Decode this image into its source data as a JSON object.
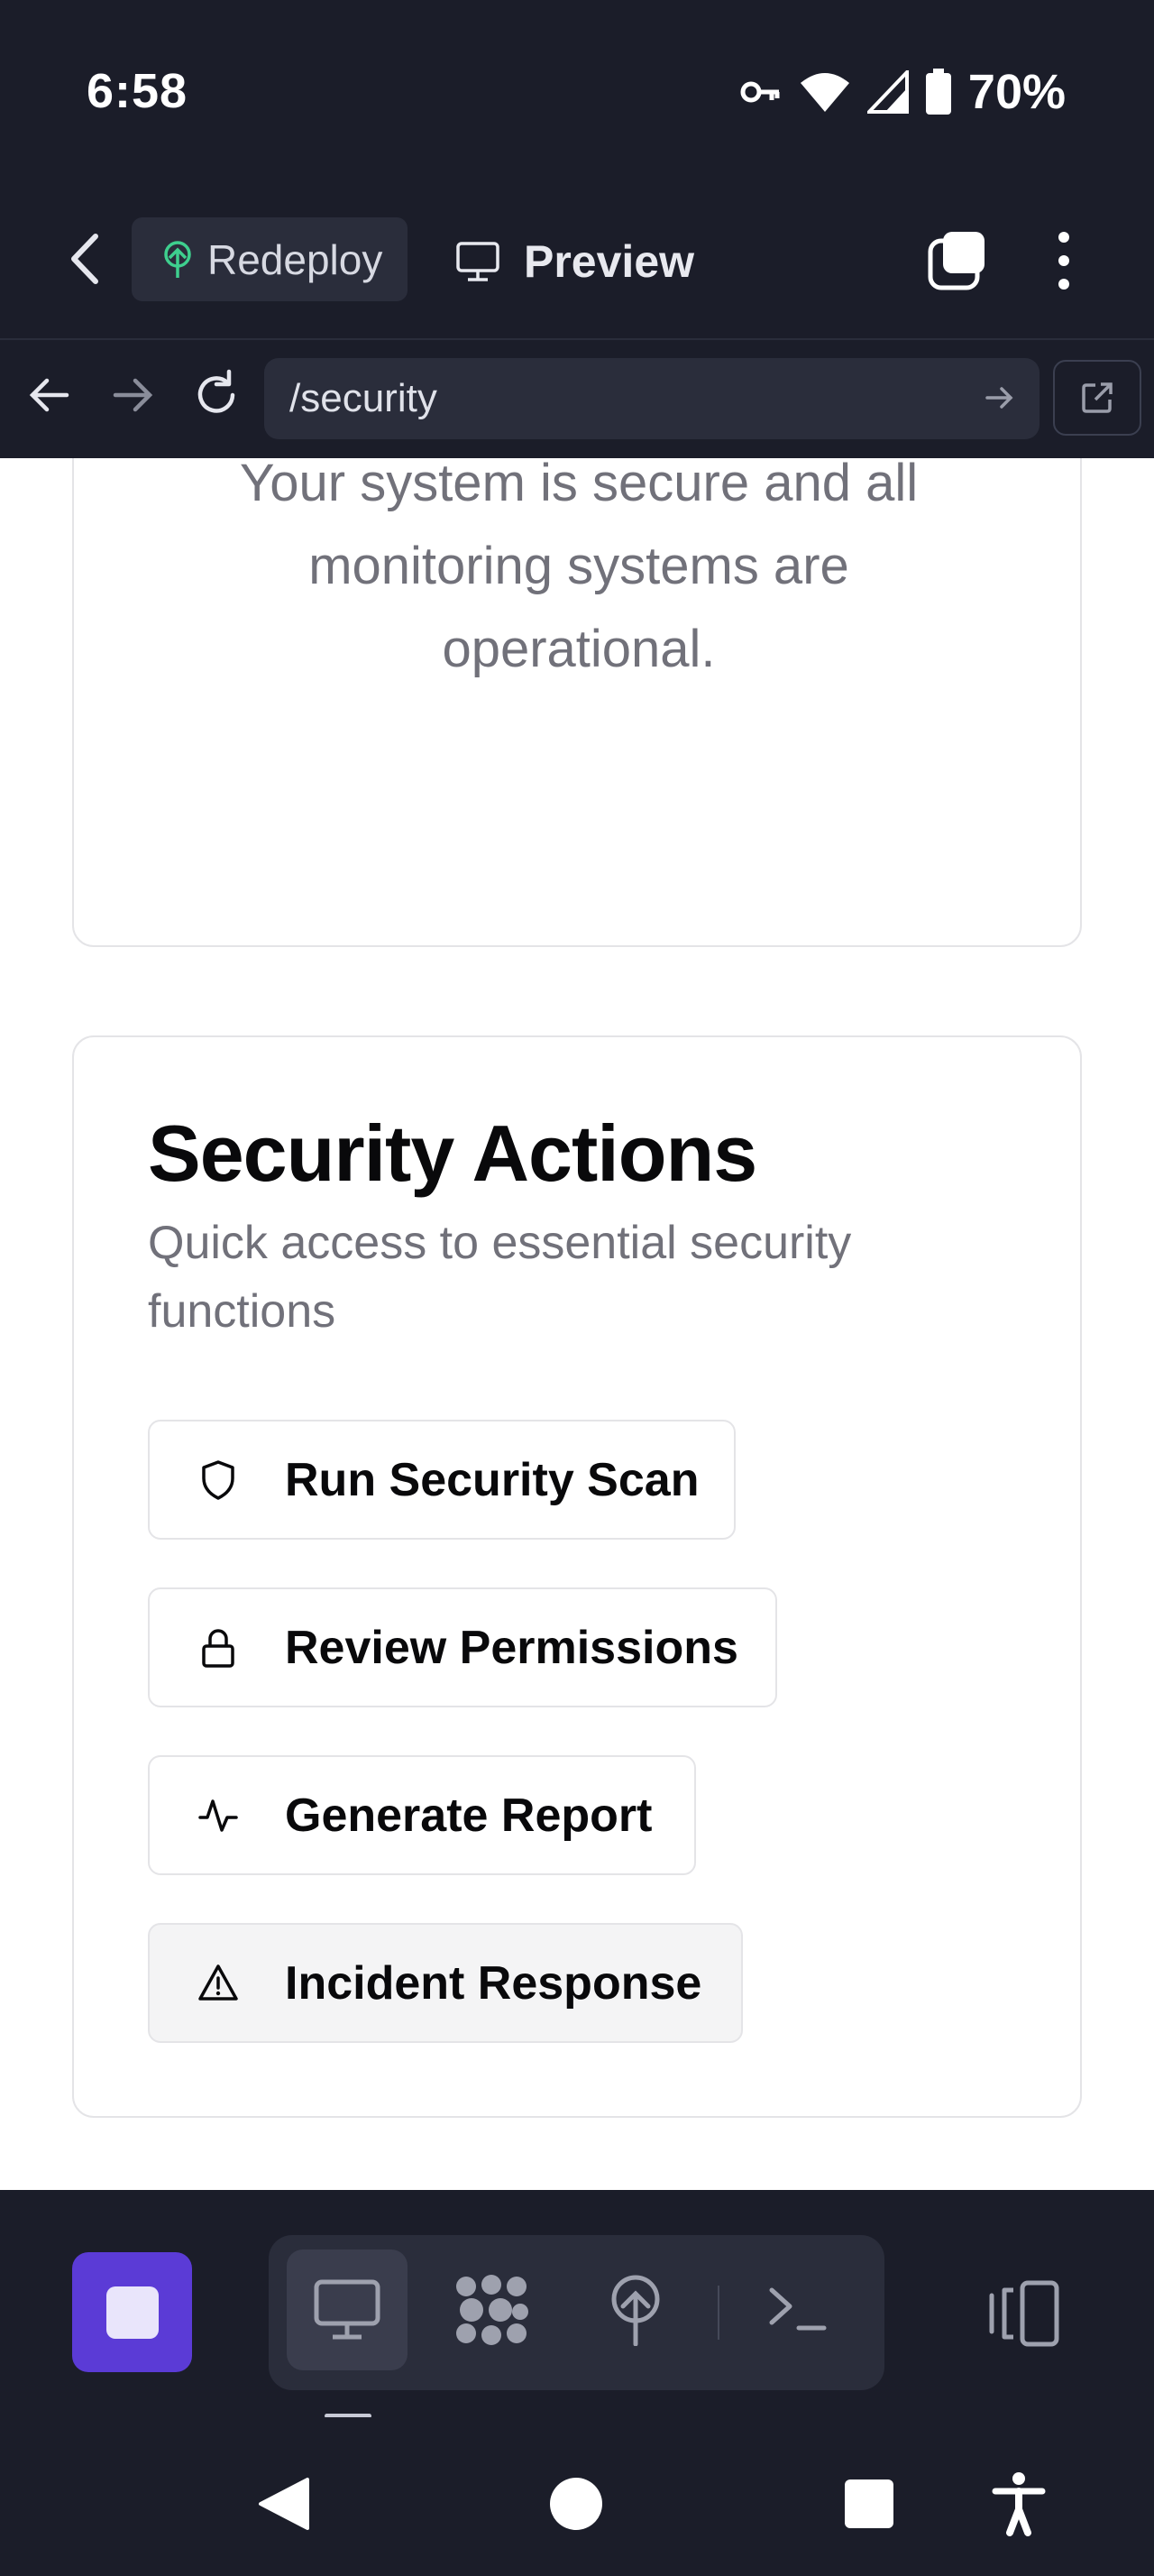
{
  "status_bar": {
    "time": "6:58",
    "battery": "70%",
    "icons": [
      "vpn-key-icon",
      "wifi-icon",
      "signal-icon",
      "battery-icon"
    ]
  },
  "app_toolbar": {
    "redeploy_label": "Redeploy",
    "preview_label": "Preview"
  },
  "url_bar": {
    "path": "/security"
  },
  "top_card": {
    "message": "Your system is secure and all monitoring systems are operational."
  },
  "actions_card": {
    "title": "Security Actions",
    "description": "Quick access to essential security functions",
    "buttons": [
      {
        "label": "Run Security Scan",
        "icon": "shield-icon"
      },
      {
        "label": "Review Permissions",
        "icon": "lock-icon"
      },
      {
        "label": "Generate Report",
        "icon": "activity-icon"
      },
      {
        "label": "Incident Response",
        "icon": "alert-triangle-icon"
      }
    ]
  },
  "bottom_toolbar": {
    "tools": [
      "desktop-icon",
      "bubbles-icon",
      "deploy-icon",
      "terminal-icon"
    ],
    "active_tool": "desktop-icon"
  },
  "colors": {
    "dark_bg": "#1b1d29",
    "accent_purple": "#5b3bd6",
    "redeploy_green": "#3ecf8e",
    "muted_text": "#71717a"
  }
}
